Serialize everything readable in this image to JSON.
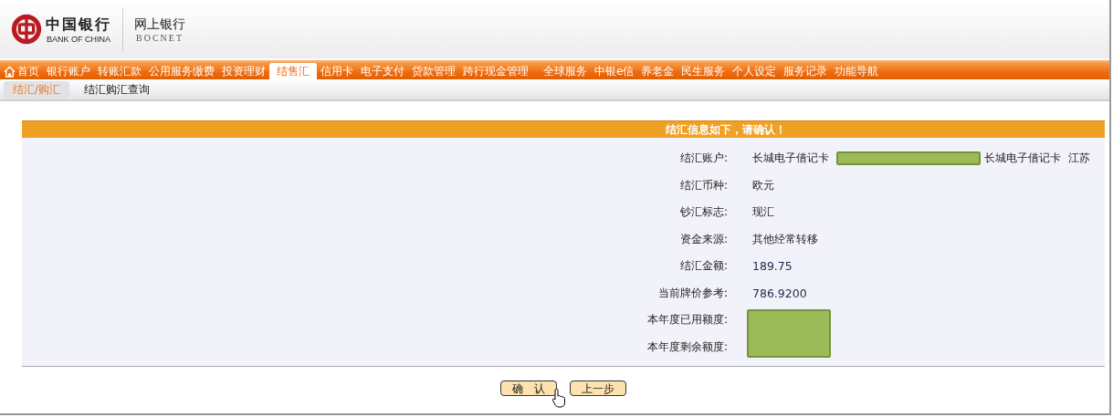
{
  "header": {
    "logo_cn": "中国银行",
    "logo_en": "BANK OF CHINA",
    "product_cn": "网上银行",
    "product_en": "BOCNET"
  },
  "nav": [
    {
      "label": "首页",
      "kind": "home",
      "selected": false
    },
    {
      "label": "银行账户",
      "selected": false
    },
    {
      "label": "转账汇款",
      "selected": false
    },
    {
      "label": "公用服务缴费",
      "selected": false
    },
    {
      "label": "投资理财",
      "selected": false
    },
    {
      "label": "结售汇",
      "selected": true
    },
    {
      "label": "信用卡",
      "selected": false
    },
    {
      "label": "电子支付",
      "selected": false
    },
    {
      "label": "贷款管理",
      "selected": false
    },
    {
      "label": "跨行现金管理",
      "selected": false
    },
    {
      "label": "全球服务",
      "selected": false
    },
    {
      "label": "中银e信",
      "selected": false
    },
    {
      "label": "养老金",
      "selected": false
    },
    {
      "label": "民生服务",
      "selected": false
    },
    {
      "label": "个人设定",
      "selected": false
    },
    {
      "label": "服务记录",
      "selected": false
    },
    {
      "label": "功能导航",
      "selected": false
    }
  ],
  "subnav": [
    {
      "label": "结汇/购汇",
      "selected": true
    },
    {
      "label": "结汇购汇查询",
      "selected": false
    }
  ],
  "panel": {
    "title": "结汇信息如下，请确认！",
    "rows": [
      {
        "label": "结汇账户:",
        "parts": [
          {
            "kind": "text",
            "text": "长城电子借记卡"
          },
          {
            "kind": "redaction"
          },
          {
            "kind": "text",
            "text": "长城电子借记卡"
          },
          {
            "kind": "text",
            "text": "江苏"
          }
        ]
      },
      {
        "label": "结汇币种:",
        "parts": [
          {
            "kind": "text",
            "text": "欧元"
          }
        ]
      },
      {
        "label": "钞汇标志:",
        "parts": [
          {
            "kind": "text",
            "text": "现汇"
          }
        ]
      },
      {
        "label": "资金来源:",
        "parts": [
          {
            "kind": "text",
            "text": "其他经常转移"
          }
        ]
      },
      {
        "label": "结汇金额:",
        "parts": [
          {
            "kind": "number",
            "text": "189.75"
          }
        ]
      },
      {
        "label": "当前牌价参考:",
        "parts": [
          {
            "kind": "number",
            "text": "786.9200"
          }
        ]
      },
      {
        "label": "本年度已用额度:",
        "parts": [
          {
            "kind": "redaction-block"
          }
        ]
      },
      {
        "label": "本年度剩余额度:",
        "parts": []
      }
    ]
  },
  "buttons": [
    {
      "label": "确　认",
      "cursor": true
    },
    {
      "label": "上一步",
      "cursor": false
    }
  ]
}
